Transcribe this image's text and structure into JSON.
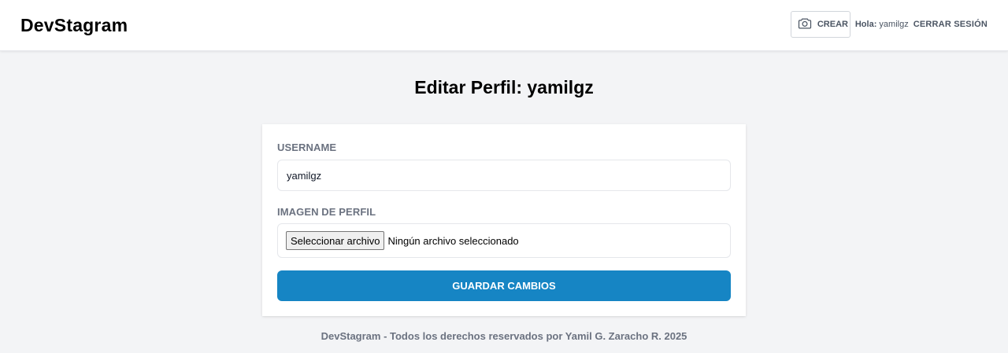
{
  "header": {
    "brand": "DevStagram",
    "create_label": "CREAR",
    "greeting_prefix": "Hola:",
    "username": "yamilgz",
    "logout_label": "CERRAR SESIÓN",
    "create_icon": "camera-icon"
  },
  "page": {
    "title": "Editar Perfil: yamilgz"
  },
  "form": {
    "username_label": "USERNAME",
    "username_value": "yamilgz",
    "image_label": "IMAGEN DE PERFIL",
    "file_button_label": "Seleccionar archivo",
    "file_status": "Ningún archivo seleccionado",
    "submit_label": "GUARDAR CAMBIOS"
  },
  "footer": {
    "text": "DevStagram - Todos los derechos reservados por Yamil G. Zaracho R. 2025"
  },
  "colors": {
    "accent": "#1685c4",
    "background": "#f3f4f6",
    "label": "#6b7280"
  }
}
